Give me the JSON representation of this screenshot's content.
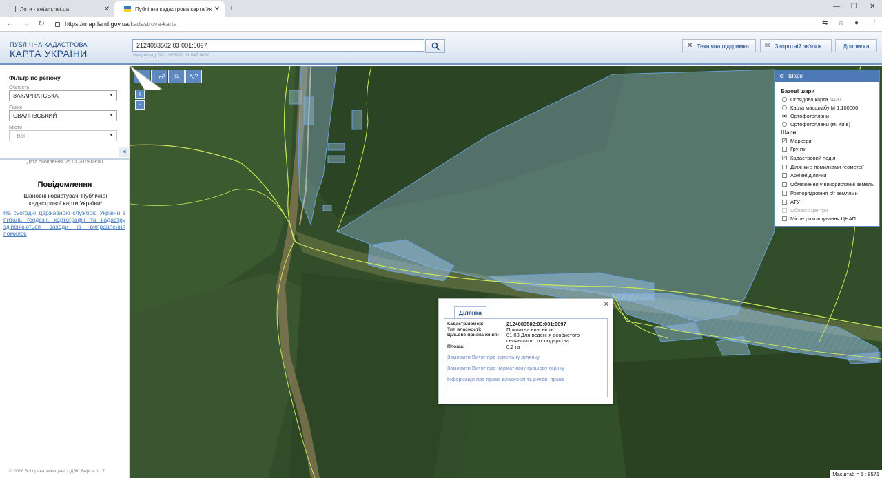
{
  "browser": {
    "tabs": [
      {
        "title": "Лоти - setam.net.ua",
        "active": false
      },
      {
        "title": "Публічна кадастрова карта Укр",
        "active": true
      }
    ],
    "url_host": "https://map.land.gov.ua",
    "url_path": "/kadastrova-karta"
  },
  "header": {
    "logo_line1": "ПУБЛІЧНА КАДАСТРОВА",
    "logo_line2": "КАРТА УКРАЇНИ",
    "search_value": "2124083502 03 001:0097",
    "search_hint": "Наприклад: 3221655100:01:047:0052",
    "buttons": {
      "support": "Технічна підтримка",
      "feedback": "Зворотній зв'язок",
      "help": "Допомога"
    }
  },
  "sidebar": {
    "filter_title": "Фільтр по регіону",
    "oblast_label": "Область",
    "oblast_value": "ЗАКАРПАТСЬКА",
    "raion_label": "Район",
    "raion_value": "СВАЛЯВСЬКИЙ",
    "misto_label": "Місто",
    "misto_value": "- Всі -",
    "update_date": "Дата оновлення: 25.03.2019 03:00",
    "notices_title": "Повідомлення",
    "notice_text": "Шановні користувачі Публічної кадастрової карти України!",
    "notice_link": "На сьогодні Державною службою України з питань геодезії, картографії та кадастру здійснюються заходи із виправлення помилок",
    "copyright": "© 2016 Всі права захищені. ЦДЗК. Версія 1.17"
  },
  "map": {
    "tools": [
      "Iн",
      "Iм",
      "print",
      "info"
    ],
    "zoom_in": "+",
    "zoom_out": "-",
    "scale_text": "Масштаб = 1 : 8571",
    "colors": {
      "parcel_fill": "#9fc6ea",
      "parcel_stroke": "#6a9fd6",
      "boundary": "#c9e85a"
    }
  },
  "layers": {
    "title": "Шари",
    "base_title": "Базові шари",
    "base": [
      {
        "label": "Оглядова карта",
        "sup": "(ЦДЗК)",
        "checked": false
      },
      {
        "label": "Карта масштабу М 1:100000",
        "checked": false
      },
      {
        "label": "Ортофотоплани",
        "checked": true
      },
      {
        "label": "Ортофотоплани (м. Київ)",
        "checked": false
      }
    ],
    "layers_title": "Шари",
    "items": [
      {
        "label": "Маркери",
        "checked": true,
        "disabled": false
      },
      {
        "label": "Грунти",
        "checked": false,
        "disabled": false
      },
      {
        "label": "Кадастровий поділ",
        "checked": true,
        "disabled": false
      },
      {
        "label": "Ділянки з помилками геометрії",
        "checked": false,
        "disabled": false
      },
      {
        "label": "Архівні ділянки",
        "checked": false,
        "disabled": false
      },
      {
        "label": "Обмеження у використанні земель",
        "checked": false,
        "disabled": false
      },
      {
        "label": "Розпорядження с/г землями",
        "checked": false,
        "disabled": false
      },
      {
        "label": "АТУ",
        "checked": false,
        "disabled": false
      },
      {
        "label": "Обласні центри",
        "checked": false,
        "disabled": true
      },
      {
        "label": "Місце розташування ЦНАП",
        "checked": false,
        "disabled": false
      }
    ]
  },
  "popup": {
    "tab": "Ділянка",
    "cad_label": "Кадастр.номер:",
    "cad_value": "2124083502:03:001:0097",
    "own_label": "Тип власності:",
    "own_value": "Приватна власність",
    "purpose_label": "Цільове призначення:",
    "purpose_value": "01.03 Для ведення особистого селянського господарства",
    "area_label": "Площа:",
    "area_value": "0.2 га",
    "links": [
      "Замовити Витяг про земельну ділянку",
      "Замовити Витяг про нормативну грошову оцінку",
      "Інформація про право власності та речові права"
    ]
  }
}
